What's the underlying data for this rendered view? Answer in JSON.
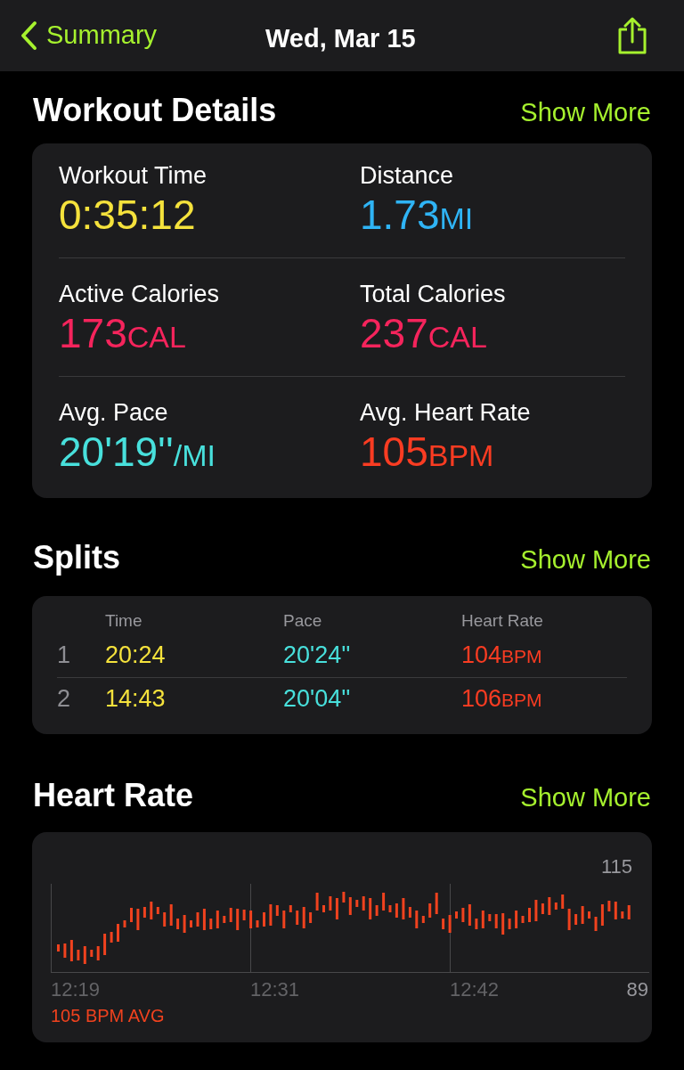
{
  "nav": {
    "back": "Summary",
    "title": "Wed, Mar 15"
  },
  "workout_details": {
    "title": "Workout Details",
    "action": "Show More",
    "metrics": [
      {
        "label": "Workout Time",
        "value": "0:35:12",
        "color": "#f5e23c"
      },
      {
        "label": "Distance",
        "value": "1.73",
        "unit": "MI",
        "color": "#2fb4f5"
      },
      {
        "label": "Active Calories",
        "value": "173",
        "unit": "CAL",
        "color": "#f5245c"
      },
      {
        "label": "Total Calories",
        "value": "237",
        "unit": "CAL",
        "color": "#f5245c"
      },
      {
        "label": "Avg. Pace",
        "value": "20'19''",
        "unit": "/MI",
        "color": "#48e0dc"
      },
      {
        "label": "Avg. Heart Rate",
        "value": "105",
        "unit": "BPM",
        "color": "#fa3c22"
      }
    ]
  },
  "splits": {
    "title": "Splits",
    "action": "Show More",
    "columns": [
      "Time",
      "Pace",
      "Heart Rate"
    ],
    "rows": [
      {
        "index": "1",
        "time": "20:24",
        "pace": "20'24''",
        "heart_rate": "104",
        "unit": "BPM"
      },
      {
        "index": "2",
        "time": "14:43",
        "pace": "20'04''",
        "heart_rate": "106",
        "unit": "BPM"
      }
    ]
  },
  "heart_rate": {
    "title": "Heart Rate",
    "action": "Show More",
    "y_max": "115",
    "y_min": "89",
    "x_labels": [
      "12:19",
      "12:31",
      "12:42"
    ],
    "average": "105 BPM AVG"
  }
}
